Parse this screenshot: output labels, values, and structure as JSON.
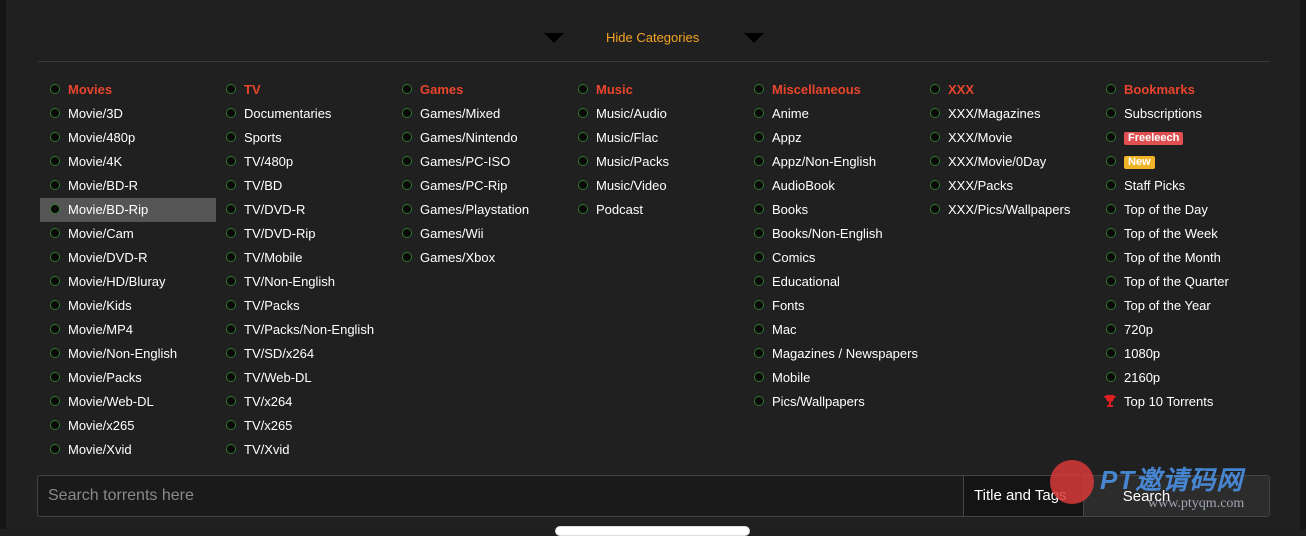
{
  "toggle": {
    "label": "Hide Categories"
  },
  "columns": [
    {
      "header": "Movies",
      "items": [
        "Movie/3D",
        "Movie/480p",
        "Movie/4K",
        "Movie/BD-R",
        "Movie/BD-Rip",
        "Movie/Cam",
        "Movie/DVD-R",
        "Movie/HD/Bluray",
        "Movie/Kids",
        "Movie/MP4",
        "Movie/Non-English",
        "Movie/Packs",
        "Movie/Web-DL",
        "Movie/x265",
        "Movie/Xvid"
      ]
    },
    {
      "header": "TV",
      "items": [
        "Documentaries",
        "Sports",
        "TV/480p",
        "TV/BD",
        "TV/DVD-R",
        "TV/DVD-Rip",
        "TV/Mobile",
        "TV/Non-English",
        "TV/Packs",
        "TV/Packs/Non-English",
        "TV/SD/x264",
        "TV/Web-DL",
        "TV/x264",
        "TV/x265",
        "TV/Xvid"
      ]
    },
    {
      "header": "Games",
      "items": [
        "Games/Mixed",
        "Games/Nintendo",
        "Games/PC-ISO",
        "Games/PC-Rip",
        "Games/Playstation",
        "Games/Wii",
        "Games/Xbox"
      ]
    },
    {
      "header": "Music",
      "items": [
        "Music/Audio",
        "Music/Flac",
        "Music/Packs",
        "Music/Video",
        "Podcast"
      ]
    },
    {
      "header": "Miscellaneous",
      "items": [
        "Anime",
        "Appz",
        "Appz/Non-English",
        "AudioBook",
        "Books",
        "Books/Non-English",
        "Comics",
        "Educational",
        "Fonts",
        "Mac",
        "Magazines / Newspapers",
        "Mobile",
        "Pics/Wallpapers"
      ]
    },
    {
      "header": "XXX",
      "items": [
        "XXX/Magazines",
        "XXX/Movie",
        "XXX/Movie/0Day",
        "XXX/Packs",
        "XXX/Pics/Wallpapers"
      ]
    },
    {
      "header": "Bookmarks",
      "items": [
        "Subscriptions",
        "Freeleech",
        "New",
        "Staff Picks",
        "Top of the Day",
        "Top of the Week",
        "Top of the Month",
        "Top of the Quarter",
        "Top of the Year",
        "720p",
        "1080p",
        "2160p",
        "Top 10 Torrents"
      ]
    }
  ],
  "selected_item": "Movie/BD-Rip",
  "badges": {
    "Freeleech": "#e05050",
    "New": "#f0b429"
  },
  "search": {
    "placeholder": "Search torrents here",
    "type_value": "Title and Tags",
    "button_label": "Search"
  },
  "watermark": {
    "title": "PT邀请码网",
    "url": "www.ptyqm.com"
  },
  "colors": {
    "accent_header": "#e8452c",
    "toggle_link": "#f5a623",
    "selected_bg": "#555555"
  }
}
